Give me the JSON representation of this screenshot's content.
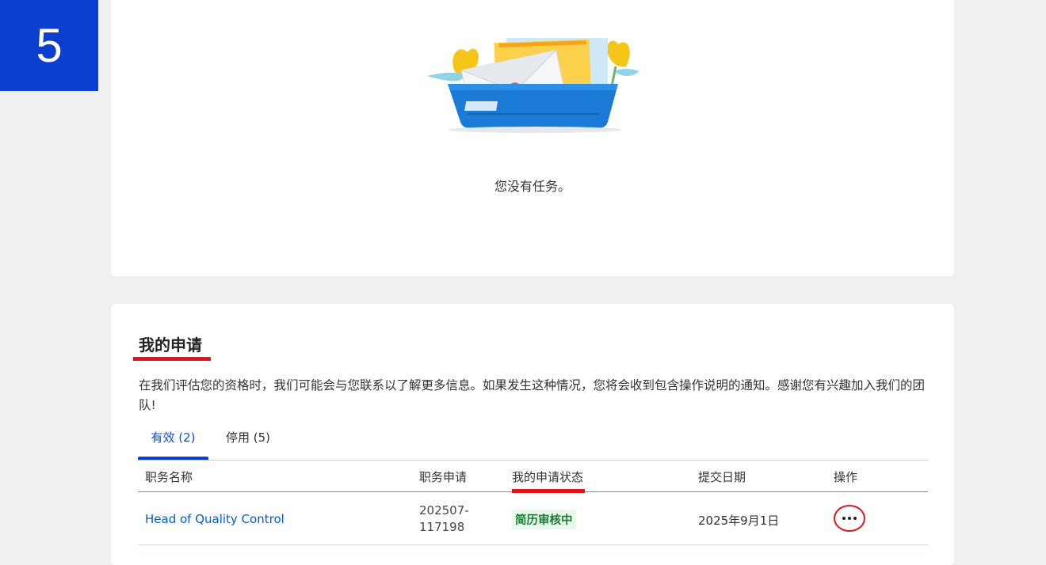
{
  "step_badge": "5",
  "tasks": {
    "empty_message": "您没有任务。"
  },
  "applications": {
    "title": "我的申请",
    "intro": "在我们评估您的资格时，我们可能会与您联系以了解更多信息。如果发生这种情况，您将会收到包含操作说明的通知。感谢您有兴趣加入我们的团队!",
    "tabs": [
      {
        "label": "有效 (2)",
        "active": true
      },
      {
        "label": "停用 (5)",
        "active": false
      }
    ],
    "columns": [
      "职务名称",
      "职务申请",
      "我的申请状态",
      "提交日期",
      "操作"
    ],
    "rows": [
      {
        "job_title": "Head of Quality Control",
        "requisition_line1": "202507-",
        "requisition_line2": "117198",
        "status": "简历审核中",
        "submitted": "2025年9月1日",
        "action_icon": "more-options-icon"
      }
    ]
  },
  "colors": {
    "brand_blue": "#0a3fcf",
    "highlight_red": "#e3141c",
    "link_blue": "#0a5bd1",
    "status_green": "#1a7d33"
  }
}
